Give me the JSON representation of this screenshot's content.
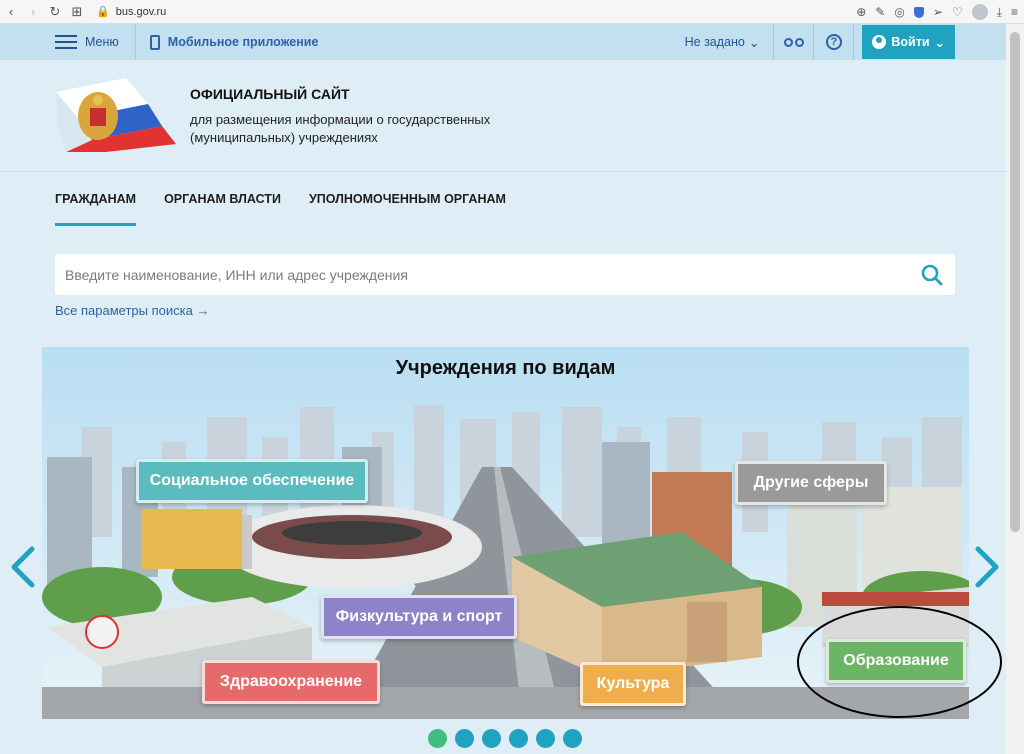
{
  "browser": {
    "url": "bus.gov.ru"
  },
  "topbar": {
    "menu_label": "Меню",
    "mobile_app_label": "Мобильное приложение",
    "region_label": "Не задано",
    "login_label": "Войти"
  },
  "header": {
    "title": "ОФИЦИАЛЬНЫЙ САЙТ",
    "subtitle": "для размещения информации о государственных (муниципальных) учреждениях"
  },
  "nav": {
    "tabs": [
      {
        "label": "ГРАЖДАНАМ",
        "active": true
      },
      {
        "label": "ОРГАНАМ ВЛАСТИ",
        "active": false
      },
      {
        "label": "УПОЛНОМОЧЕННЫМ ОРГАНАМ",
        "active": false
      }
    ]
  },
  "search": {
    "placeholder": "Введите наименование, ИНН или адрес учреждения",
    "advanced_link": "Все параметры поиска →"
  },
  "carousel": {
    "title": "Учреждения по видам",
    "categories": {
      "social": "Социальное обеспечение",
      "other": "Другие сферы",
      "sport": "Физкультура и спорт",
      "health": "Здравоохранение",
      "culture": "Культура",
      "education": "Образование"
    },
    "page_count": 6,
    "active_page": 1
  },
  "colors": {
    "accent": "#1fa3c1",
    "link": "#2e63a3",
    "active_dot": "#3fbf7f"
  }
}
